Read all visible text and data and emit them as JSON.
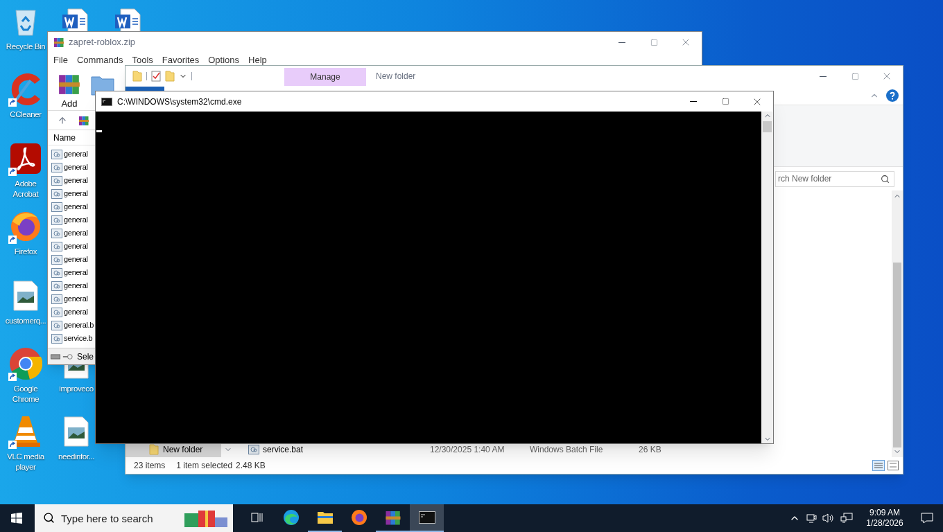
{
  "desktop_icons": [
    {
      "kind": "recycle",
      "label": "Recycle Bin"
    },
    {
      "kind": "word"
    },
    {
      "kind": "word"
    },
    {
      "kind": "ccleaner",
      "label": "CCleaner",
      "shortcut": true
    },
    {
      "kind": "acrobat",
      "label": "Adobe Acrobat",
      "shortcut": true
    },
    {
      "kind": "firefox",
      "label": "Firefox",
      "shortcut": true
    },
    {
      "kind": "image",
      "label": "customerq..."
    },
    {
      "kind": "chrome",
      "label": "Google Chrome",
      "shortcut": true
    },
    {
      "kind": "image",
      "label": "improveco"
    },
    {
      "kind": "vlc",
      "label": "VLC media player",
      "shortcut": true
    },
    {
      "kind": "image",
      "label": "needinfor..."
    }
  ],
  "winrar": {
    "title": "zapret-roblox.zip",
    "menu": [
      "File",
      "Commands",
      "Tools",
      "Favorites",
      "Options",
      "Help"
    ],
    "toolbar": [
      "Add"
    ],
    "column": "Name",
    "files": [
      "general",
      "general",
      "general",
      "general",
      "general",
      "general",
      "general",
      "general",
      "general",
      "general",
      "general",
      "general",
      "general",
      "general.b",
      "service.b"
    ],
    "status": "Sele"
  },
  "explorer": {
    "title": "New folder",
    "ribbon_tab": "Manage",
    "search": {
      "placeholder": "rch New folder"
    },
    "nav_item": {
      "label": "New folder",
      "selected": true
    },
    "file": {
      "name": "service.bat",
      "date": "12/30/2025 1:40 AM",
      "type": "Windows Batch File",
      "size": "26 KB"
    },
    "status": {
      "count": "23 items",
      "selection": "1 item selected",
      "size": "2.48 KB"
    }
  },
  "cmd": {
    "title": "C:\\WINDOWS\\system32\\cmd.exe"
  },
  "taskbar": {
    "search": {
      "placeholder": "Type here to search"
    },
    "apps": [
      {
        "kind": "taskview",
        "running": false,
        "selected": false
      },
      {
        "kind": "edge",
        "running": false,
        "selected": false
      },
      {
        "kind": "explorer",
        "running": true,
        "selected": false
      },
      {
        "kind": "firefox",
        "running": false,
        "selected": false
      },
      {
        "kind": "winrar",
        "running": true,
        "selected": false
      },
      {
        "kind": "cmd",
        "running": true,
        "selected": true
      }
    ],
    "time": "9:09 AM",
    "date": "1/28/2026"
  }
}
